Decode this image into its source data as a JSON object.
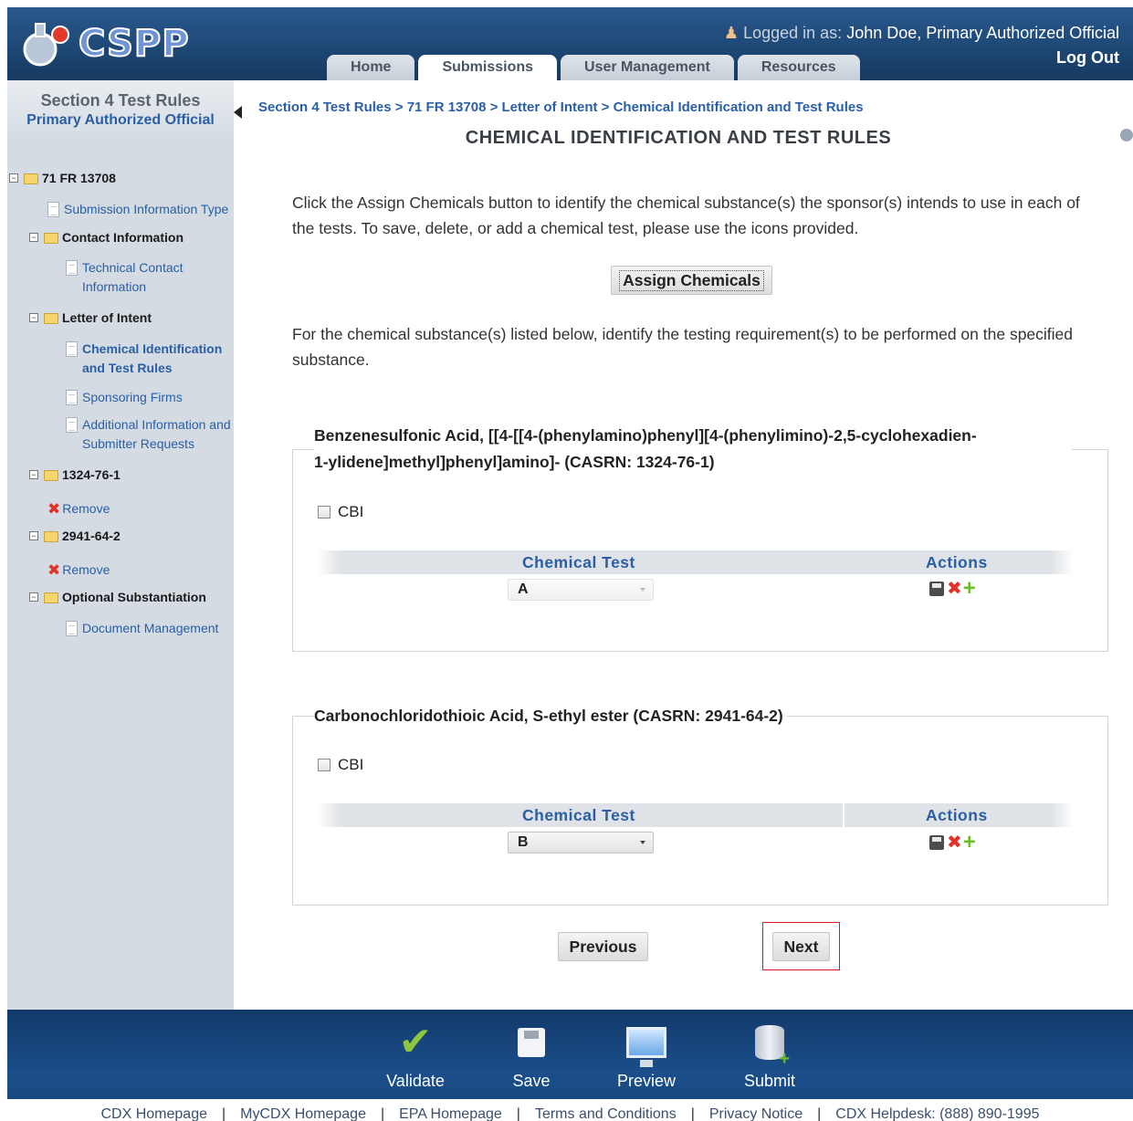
{
  "header": {
    "logo_text": "CSPP",
    "logged_in_label": "Logged in as:",
    "user": "John Doe, Primary Authorized Official",
    "logout": "Log Out",
    "tabs": [
      {
        "label": "Home",
        "active": false
      },
      {
        "label": "Submissions",
        "active": true
      },
      {
        "label": "User Management",
        "active": false
      },
      {
        "label": "Resources",
        "active": false
      }
    ]
  },
  "sidebar": {
    "title": "Section 4 Test Rules",
    "subtitle": "Primary Authorized Official",
    "tree": {
      "root": "71 FR 13708",
      "submission_info": "Submission Information Type",
      "contact_info": "Contact Information",
      "technical_contact_1": "Technical Contact",
      "technical_contact_2": "Information",
      "letter_of_intent": "Letter of Intent",
      "chem_id_1": "Chemical Identification",
      "chem_id_2": "and Test Rules",
      "sponsoring_firms": "Sponsoring Firms",
      "additional_1": "Additional Information and",
      "additional_2": "Submitter Requests",
      "cas1": "1324-76-1",
      "remove1": "Remove",
      "cas2": "2941-64-2",
      "remove2": "Remove",
      "optional": "Optional Substantiation",
      "doc_mgmt": "Document Management"
    }
  },
  "main": {
    "breadcrumb": "Section 4 Test Rules > 71 FR 13708 > Letter of Intent > Chemical Identification and Test Rules",
    "title": "CHEMICAL IDENTIFICATION AND TEST RULES",
    "instructions_1": "Click the Assign Chemicals button to identify the chemical substance(s) the sponsor(s) intends to use in each of the tests. To save, delete, or add a chemical test, please use the icons provided.",
    "assign_button": "Assign Chemicals",
    "instructions_2": "For the chemical substance(s) listed below, identify the testing requirement(s) to be performed on the specified substance.",
    "chemicals": [
      {
        "legend_line1": "Benzenesulfonic Acid, [[4-[[4-(phenylamino)phenyl][4-(phenylimino)-2,5-cyclohexadien-",
        "legend_line2": "1-ylidene]methyl]phenyl]amino]- (CASRN: 1324-76-1)",
        "cbi_label": "CBI",
        "col_test": "Chemical Test",
        "col_actions": "Actions",
        "selected_test": "A",
        "select_disabled": true
      },
      {
        "legend_line1": "Carbonochloridothioic Acid, S-ethyl ester (CASRN: 2941-64-2)",
        "cbi_label": "CBI",
        "col_test": "Chemical Test",
        "col_actions": "Actions",
        "selected_test": "B",
        "select_disabled": false
      }
    ],
    "previous_button": "Previous",
    "next_button": "Next"
  },
  "footer": {
    "actions": [
      {
        "label": "Validate",
        "icon": "checkmark-icon"
      },
      {
        "label": "Save",
        "icon": "floppy-icon"
      },
      {
        "label": "Preview",
        "icon": "monitor-icon"
      },
      {
        "label": "Submit",
        "icon": "database-icon"
      }
    ],
    "links": [
      "CDX Homepage",
      "MyCDX Homepage",
      "EPA Homepage",
      "Terms and Conditions",
      "Privacy Notice",
      "CDX Helpdesk: (888) 890-1995"
    ],
    "separator": "|"
  },
  "colors": {
    "header_blue": "#1d4673",
    "link_blue": "#2a5fa6",
    "sidebar_bg": "#d4dbe3",
    "highlight_red": "#d71920"
  }
}
